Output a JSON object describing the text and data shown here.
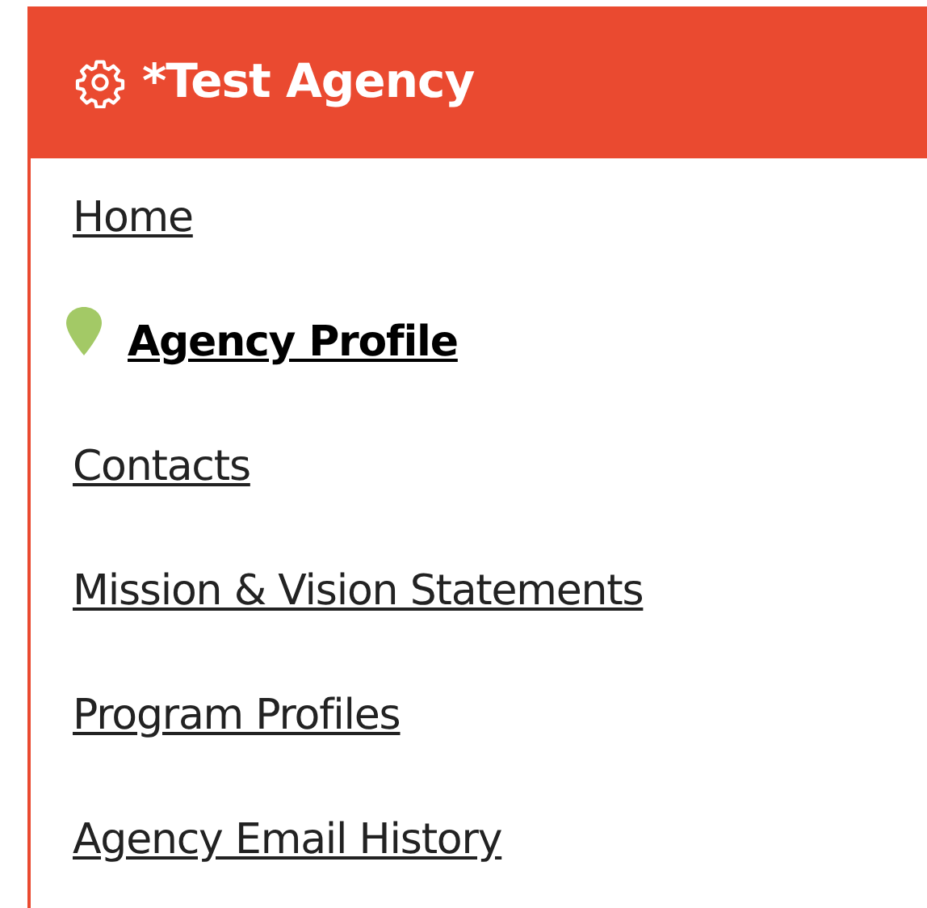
{
  "header": {
    "title": "*Test Agency"
  },
  "nav": {
    "items": [
      {
        "label": "Home",
        "selected": false
      },
      {
        "label": "Agency Profile",
        "selected": true
      },
      {
        "label": "Contacts",
        "selected": false
      },
      {
        "label": "Mission & Vision Statements",
        "selected": false
      },
      {
        "label": "Program Profiles",
        "selected": false
      },
      {
        "label": "Agency Email History",
        "selected": false
      }
    ]
  }
}
